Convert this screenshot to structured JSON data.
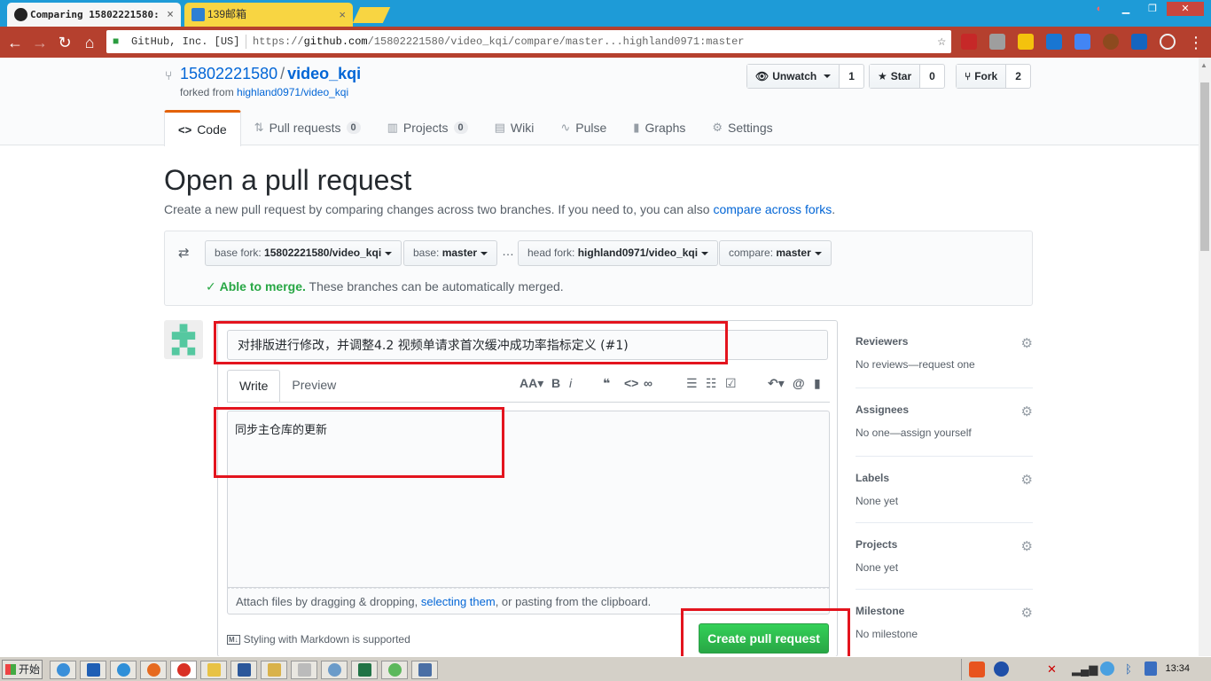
{
  "browser": {
    "tabs": [
      {
        "title": "Comparing 15802221580:",
        "close": "×"
      },
      {
        "title": "139邮箱",
        "close": "×"
      }
    ],
    "secure_label": "GitHub, Inc. [US]",
    "url_scheme": "https://",
    "url_host": "github.com",
    "url_path": "/15802221580/video_kqi/compare/master...highland0971:master"
  },
  "repo": {
    "owner": "15802221580",
    "separator": "/",
    "name": "video_kqi",
    "forked_prefix": "forked from",
    "forked_from": "highland0971/video_kqi",
    "watch_label": "Unwatch",
    "watch_count": "1",
    "star_label": "Star",
    "star_count": "0",
    "fork_label": "Fork",
    "fork_count": "2"
  },
  "nav": {
    "code": "Code",
    "pulls": "Pull requests",
    "pulls_count": "0",
    "projects": "Projects",
    "projects_count": "0",
    "wiki": "Wiki",
    "pulse": "Pulse",
    "graphs": "Graphs",
    "settings": "Settings"
  },
  "page": {
    "title": "Open a pull request",
    "subtitle": "Create a new pull request by comparing changes across two branches. If you need to, you can also",
    "subtitle_link": "compare across forks",
    "subtitle_end": "."
  },
  "range": {
    "base_fork_label": "base fork:",
    "base_fork_value": "15802221580/video_kqi",
    "base_label": "base:",
    "base_value": "master",
    "ellipsis": "…",
    "head_fork_label": "head fork:",
    "head_fork_value": "highland0971/video_kqi",
    "compare_label": "compare:",
    "compare_value": "master",
    "merge_ok": "Able to merge.",
    "merge_text": "These branches can be automatically merged."
  },
  "form": {
    "title_value": "对排版进行修改，并调整4.2 视频单请求首次缓冲成功率指标定义 (#1)",
    "tab_write": "Write",
    "tab_preview": "Preview",
    "body_value": "同步主仓库的更新",
    "attach_text1": "Attach files by dragging & dropping,",
    "attach_link": "selecting them",
    "attach_text2": ", or pasting from the clipboard.",
    "md_note": "Styling with Markdown is supported",
    "submit": "Create pull request"
  },
  "sidebar": {
    "reviewers": {
      "title": "Reviewers",
      "value": "No reviews—request one"
    },
    "assignees": {
      "title": "Assignees",
      "value": "No one—assign yourself"
    },
    "labels": {
      "title": "Labels",
      "value": "None yet"
    },
    "projects": {
      "title": "Projects",
      "value": "None yet"
    },
    "milestone": {
      "title": "Milestone",
      "value": "No milestone"
    }
  },
  "taskbar": {
    "start": "开始",
    "clock": "13:34"
  },
  "colors": {
    "highlight": "#e3141e",
    "tabbar": "#1e9bd7",
    "toolbar": "#b5402e",
    "link": "#0366d6",
    "merge_green": "#28a745"
  }
}
